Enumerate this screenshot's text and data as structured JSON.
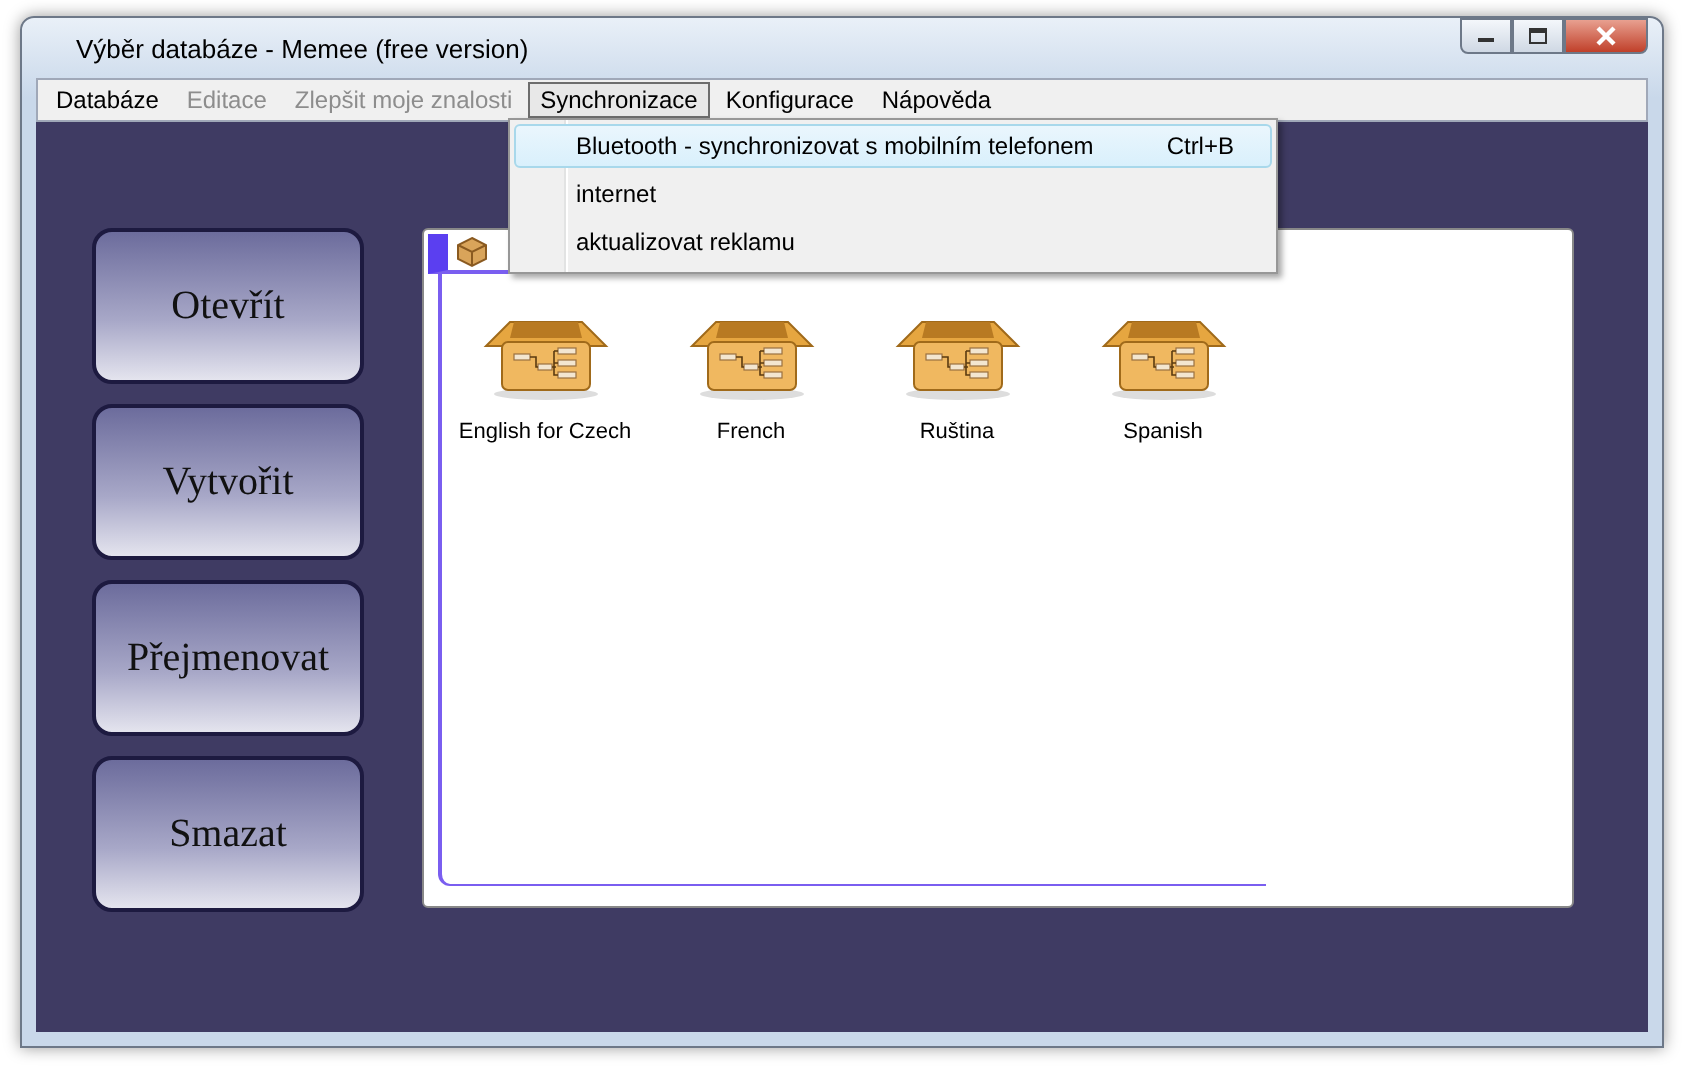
{
  "window": {
    "title": "Výběr databáze - Memee (free version)"
  },
  "menu": [
    {
      "label": "Databáze",
      "disabled": false,
      "selected": false
    },
    {
      "label": "Editace",
      "disabled": true,
      "selected": false
    },
    {
      "label": "Zlepšit moje znalosti",
      "disabled": true,
      "selected": false
    },
    {
      "label": "Synchronizace",
      "disabled": false,
      "selected": true
    },
    {
      "label": "Konfigurace",
      "disabled": false,
      "selected": false
    },
    {
      "label": "Nápověda",
      "disabled": false,
      "selected": false
    }
  ],
  "dropdown": [
    {
      "label": "Bluetooth - synchronizovat s mobilním telefonem",
      "shortcut": "Ctrl+B",
      "selected": true
    },
    {
      "label": "internet",
      "selected": false
    },
    {
      "label": "aktualizovat reklamu",
      "selected": false
    }
  ],
  "actions": [
    "Otevřít",
    "Vytvořit",
    "Přejmenovat",
    "Smazat"
  ],
  "panel": {
    "databases": [
      {
        "name": "English for Czech"
      },
      {
        "name": "French"
      },
      {
        "name": "Ruština"
      },
      {
        "name": "Spanish"
      }
    ]
  }
}
